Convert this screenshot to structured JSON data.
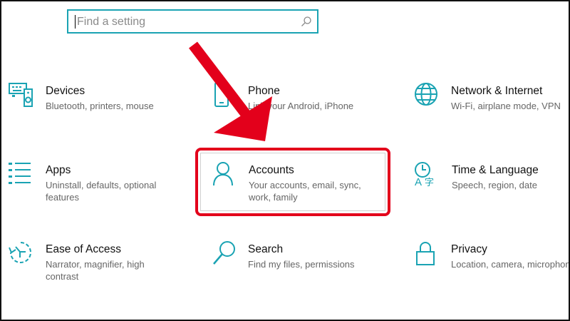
{
  "search": {
    "placeholder": "Find a setting",
    "icon": "search-icon"
  },
  "tiles": [
    {
      "title": "Devices",
      "desc": "Bluetooth, printers, mouse",
      "icon": "keyboard-speaker-icon"
    },
    {
      "title": "Phone",
      "desc": "Link your Android, iPhone",
      "icon": "phone-icon"
    },
    {
      "title": "Network & Internet",
      "desc": "Wi-Fi, airplane mode, VPN",
      "icon": "globe-icon"
    },
    {
      "title": "Apps",
      "desc": "Uninstall, defaults, optional features",
      "icon": "list-icon"
    },
    {
      "title": "Accounts",
      "desc": "Your accounts, email, sync, work, family",
      "icon": "person-icon"
    },
    {
      "title": "Time & Language",
      "desc": "Speech, region, date",
      "icon": "time-language-icon"
    },
    {
      "title": "Ease of Access",
      "desc": "Narrator, magnifier, high contrast",
      "icon": "ease-of-access-icon"
    },
    {
      "title": "Search",
      "desc": "Find my files, permissions",
      "icon": "search-icon"
    },
    {
      "title": "Privacy",
      "desc": "Location, camera, microphone",
      "icon": "lock-icon"
    }
  ],
  "colors": {
    "accent": "#1aa3b3",
    "highlight": "#e3001b",
    "text": "#111111",
    "subtext": "#666666"
  }
}
